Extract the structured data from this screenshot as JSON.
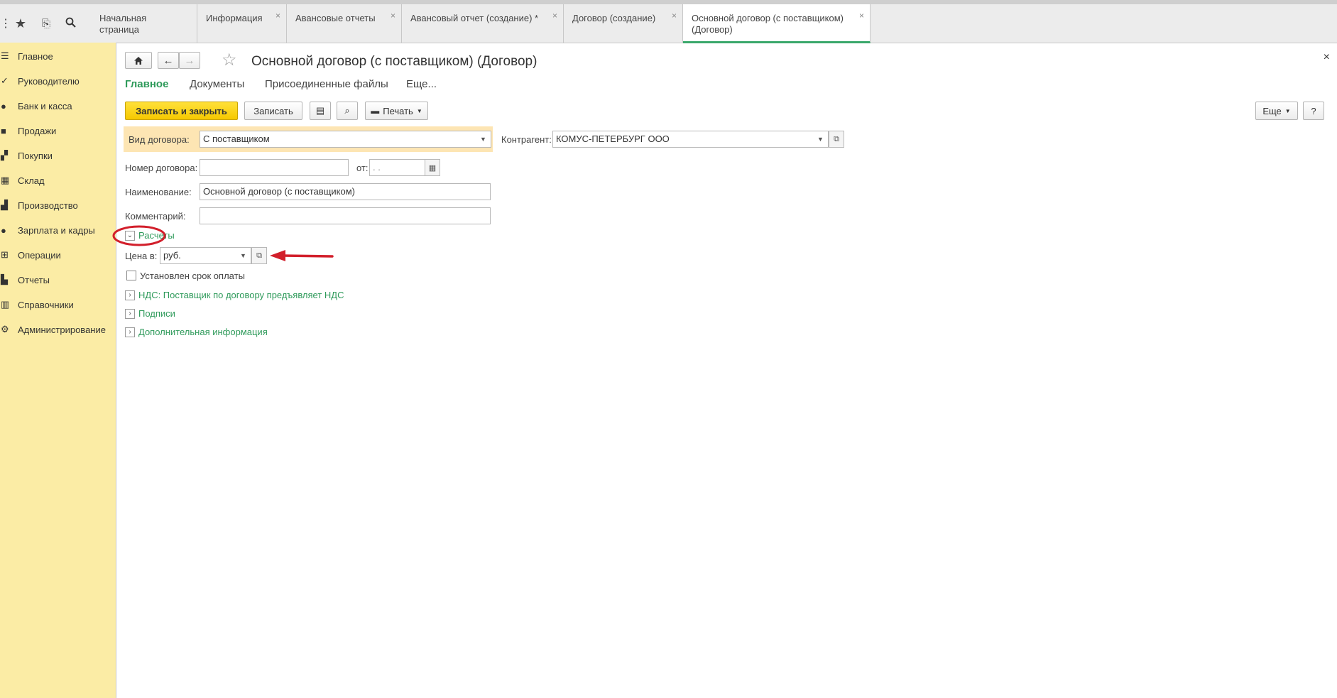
{
  "tabs": [
    {
      "label": "Начальная страница",
      "closable": false,
      "active": false
    },
    {
      "label": "Информация",
      "closable": true,
      "active": false
    },
    {
      "label": "Авансовые отчеты",
      "closable": true,
      "active": false
    },
    {
      "label": "Авансовый отчет (создание) *",
      "closable": true,
      "active": false
    },
    {
      "label": "Договор (создание)",
      "closable": true,
      "active": false
    },
    {
      "label": "Основной договор (с поставщиком) (Договор)",
      "closable": true,
      "active": true
    }
  ],
  "tab_close_glyph": "×",
  "sidebar": {
    "items": [
      {
        "icon": "list-icon",
        "label": "Главное"
      },
      {
        "icon": "chart-icon",
        "label": "Руководителю"
      },
      {
        "icon": "coin-icon",
        "label": "Банк и касса"
      },
      {
        "icon": "bag-icon",
        "label": "Продажи"
      },
      {
        "icon": "cart-icon",
        "label": "Покупки"
      },
      {
        "icon": "warehouse-icon",
        "label": "Склад"
      },
      {
        "icon": "factory-icon",
        "label": "Производство"
      },
      {
        "icon": "person-icon",
        "label": "Зарплата и кадры"
      },
      {
        "icon": "operations-icon",
        "label": "Операции"
      },
      {
        "icon": "report-icon",
        "label": "Отчеты"
      },
      {
        "icon": "book-icon",
        "label": "Справочники"
      },
      {
        "icon": "gear-icon",
        "label": "Администрирование"
      }
    ]
  },
  "form": {
    "title": "Основной договор (с поставщиком) (Договор)",
    "close_glyph": "×",
    "subnav": [
      "Главное",
      "Документы",
      "Присоединенные файлы",
      "Еще..."
    ],
    "toolbar": {
      "save_close": "Записать и закрыть",
      "save": "Записать",
      "print": "Печать",
      "more": "Еще",
      "help": "?"
    },
    "contract_type_label": "Вид договора:",
    "contract_type_value": "С поставщиком",
    "counterparty_label": "Контрагент:",
    "counterparty_value": "КОМУС-ПЕТЕРБУРГ ООО",
    "number_label": "Номер договора:",
    "number_value": "",
    "date_label": "от:",
    "date_value": " .  .",
    "name_label": "Наименование:",
    "name_value": "Основной договор (с поставщиком)",
    "comment_label": "Комментарий:",
    "comment_value": "",
    "payments_group": "Расчеты",
    "price_label": "Цена в:",
    "price_value": "руб.",
    "payment_term_label": "Установлен срок оплаты",
    "payment_term_checked": false,
    "vat_group": "НДС: Поставщик по договору предъявляет НДС",
    "signatures_group": "Подписи",
    "additional_group": "Дополнительная информация"
  },
  "colors": {
    "accent_green": "#2e9a5a",
    "primary_button": "#f6c900",
    "sidebar_bg": "#fbeca5",
    "highlight_bg": "#fde5b3",
    "annotation_red": "#d21f2b"
  }
}
